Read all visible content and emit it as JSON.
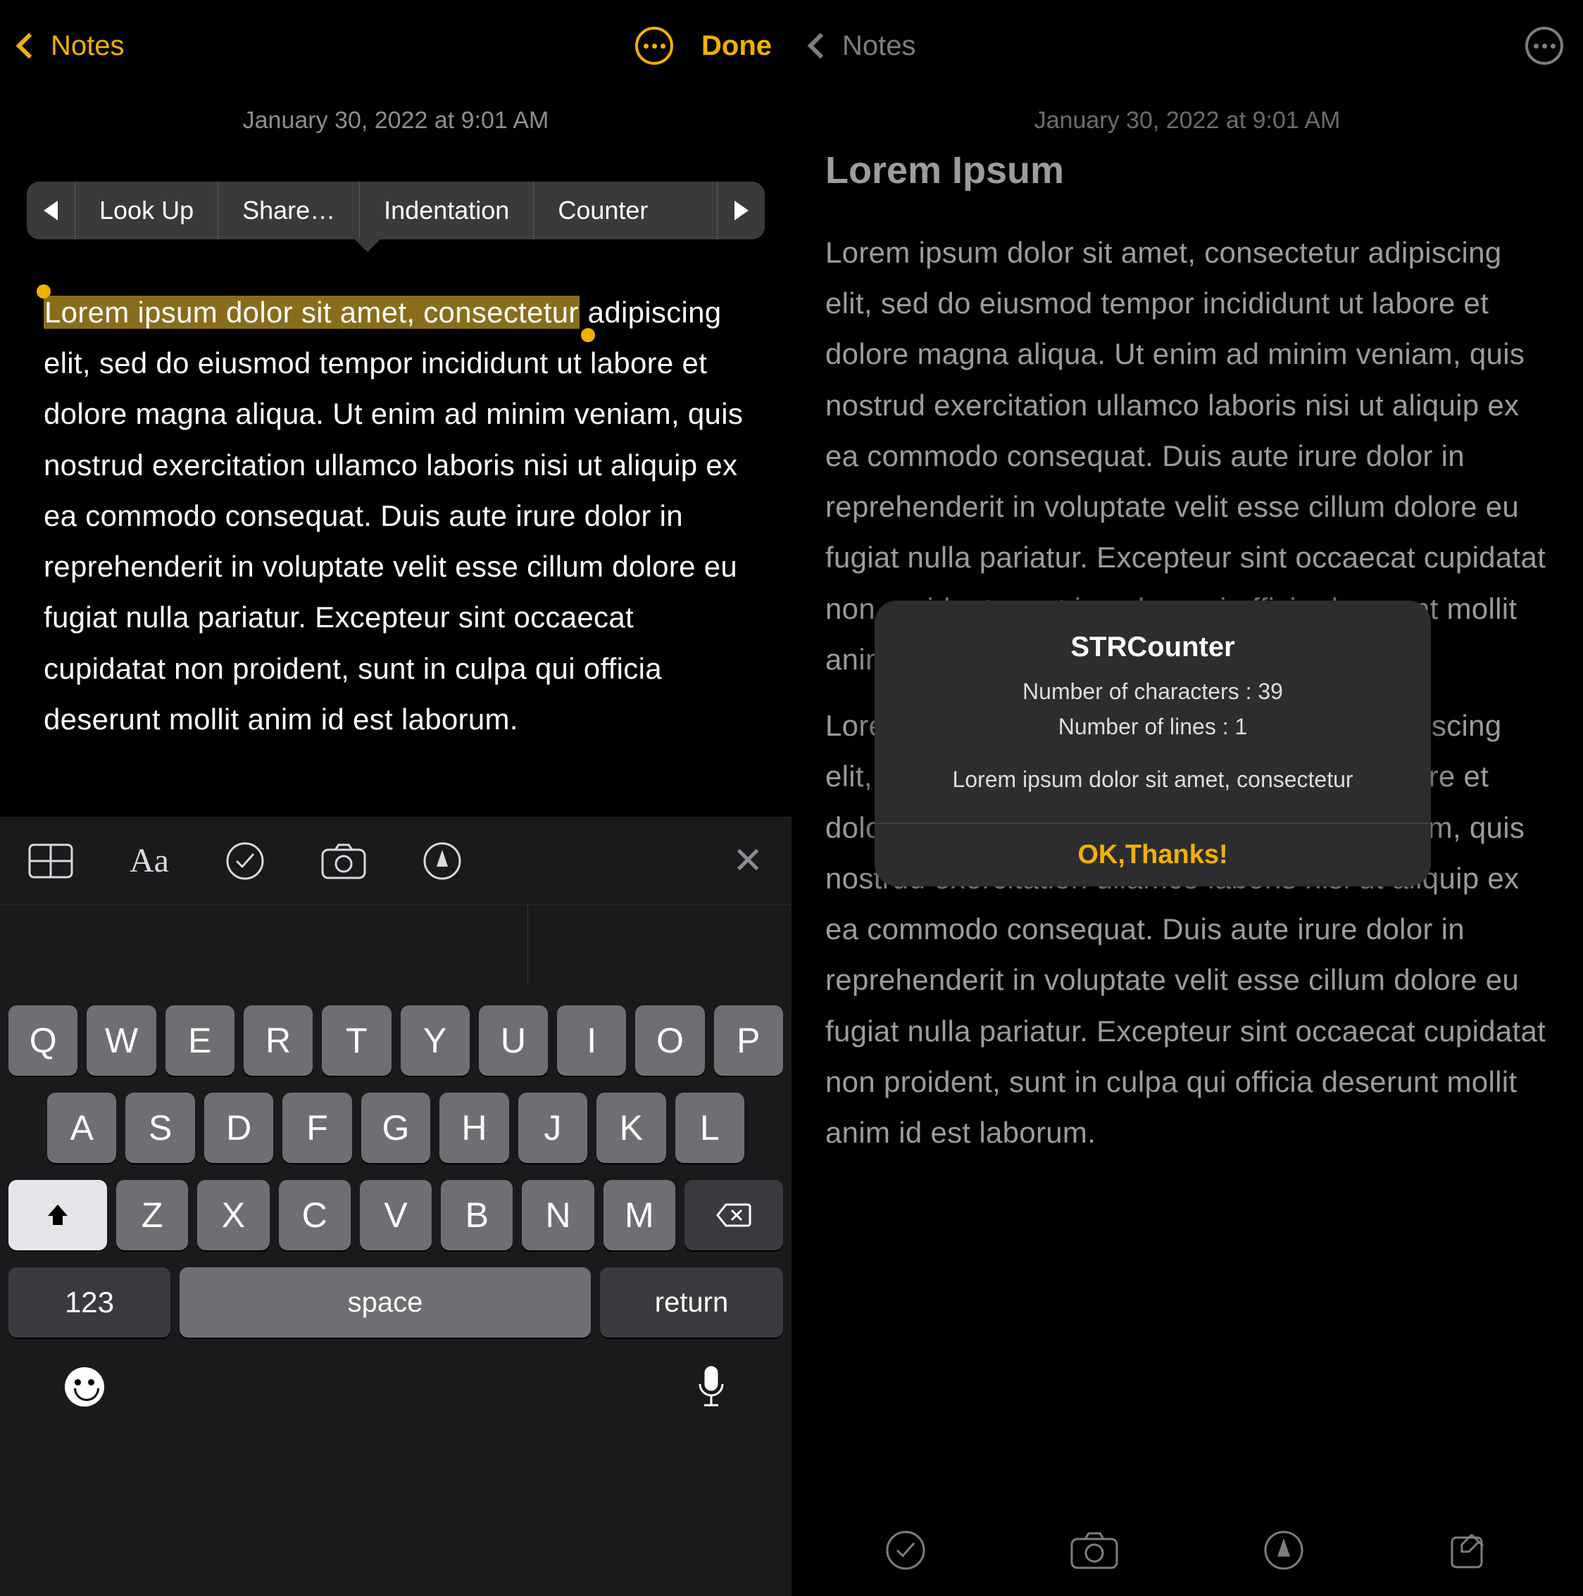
{
  "left": {
    "nav": {
      "back_label": "Notes",
      "done_label": "Done"
    },
    "date": "January 30, 2022 at 9:01 AM",
    "context_menu": {
      "items": [
        "Look Up",
        "Share…",
        "Indentation",
        "Counter"
      ]
    },
    "selected_text": "Lorem ipsum dolor sit amet, consectetur",
    "body_rest": "adipiscing elit, sed do eiusmod tempor incididunt ut labore et dolore magna aliqua. Ut enim ad minim veniam, quis nostrud exercitation ullamco laboris nisi ut aliquip ex ea commodo consequat. Duis aute irure dolor in reprehenderit in voluptate velit esse cillum dolore eu fugiat nulla pariatur. Excepteur sint occaecat cupidatat non proident, sunt in culpa qui officia deserunt mollit anim id est laborum.",
    "toolbar_icons": [
      "table-icon",
      "text-format-icon",
      "checklist-icon",
      "camera-icon",
      "markup-icon",
      "close-icon"
    ],
    "keyboard": {
      "row1": [
        "Q",
        "W",
        "E",
        "R",
        "T",
        "Y",
        "U",
        "I",
        "O",
        "P"
      ],
      "row2": [
        "A",
        "S",
        "D",
        "F",
        "G",
        "H",
        "J",
        "K",
        "L"
      ],
      "row3": [
        "Z",
        "X",
        "C",
        "V",
        "B",
        "N",
        "M"
      ],
      "numbers_key": "123",
      "space_key": "space",
      "return_key": "return"
    }
  },
  "right": {
    "nav": {
      "back_label": "Notes"
    },
    "date": "January 30, 2022 at 9:01 AM",
    "title": "Lorem Ipsum",
    "body_p1": "Lorem ipsum dolor sit amet, consectetur adipiscing elit, sed do eiusmod tempor incididunt ut labore et dolore magna aliqua. Ut enim ad minim veniam, quis nostrud exercitation ullamco laboris nisi ut aliquip ex ea commodo consequat. Duis aute irure dolor in reprehenderit in voluptate velit esse cillum dolore eu fugiat nulla pariatur. Excepteur sint occaecat cupidatat non proident, sunt in culpa qui officia deserunt mollit anim id est laborum.",
    "body_p2": "Lorem ipsum dolor sit amet, consectetur adipiscing elit, sed do eiusmod tempor incididunt ut labore et dolore magna aliqua. Ut enim ad minim veniam, quis nostrud exercitation ullamco laboris nisi ut aliquip ex ea commodo consequat. Duis aute irure dolor in reprehenderit in voluptate velit esse cillum dolore eu fugiat nulla pariatur. Excepteur sint occaecat cupidatat non proident, sunt in culpa qui officia deserunt mollit anim id est laborum.",
    "alert": {
      "title": "STRCounter",
      "line1": "Number of characters : 39",
      "line2": "Number of lines : 1",
      "sample": "Lorem ipsum dolor sit amet, consectetur",
      "button": "OK,Thanks!"
    },
    "toolbar_icons": [
      "checklist-icon",
      "camera-icon",
      "markup-icon",
      "compose-icon"
    ]
  },
  "colors": {
    "accent": "#f2b100",
    "dim": "#7d7d82"
  }
}
